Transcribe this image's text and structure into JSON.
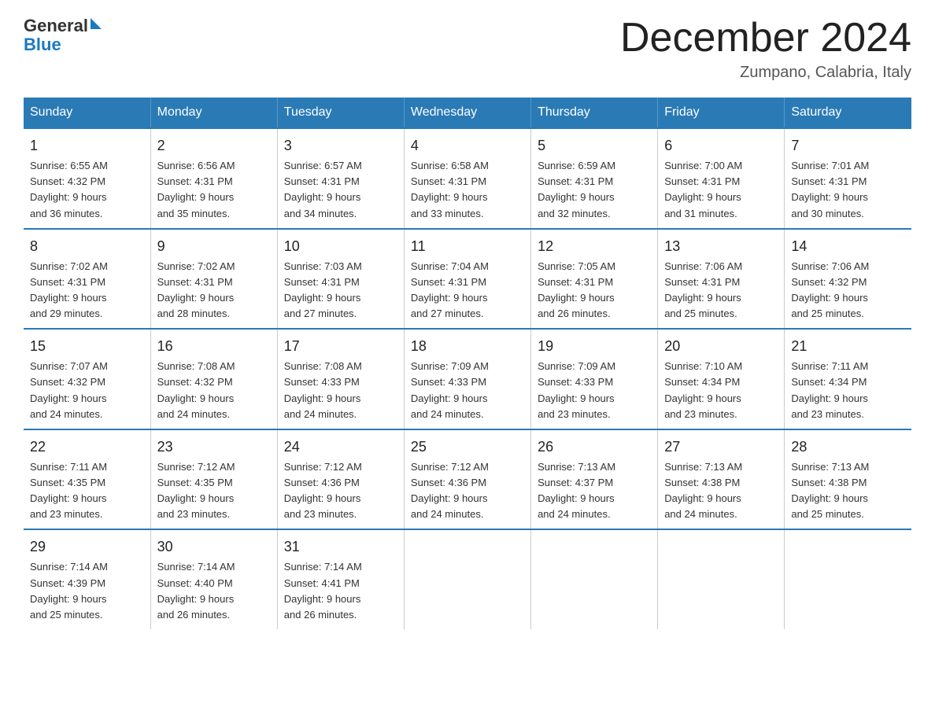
{
  "logo": {
    "line1": "General",
    "triangle": "▶",
    "line2": "Blue"
  },
  "title": "December 2024",
  "location": "Zumpano, Calabria, Italy",
  "days_of_week": [
    "Sunday",
    "Monday",
    "Tuesday",
    "Wednesday",
    "Thursday",
    "Friday",
    "Saturday"
  ],
  "weeks": [
    [
      {
        "day": "1",
        "sunrise": "6:55 AM",
        "sunset": "4:32 PM",
        "daylight": "9 hours and 36 minutes."
      },
      {
        "day": "2",
        "sunrise": "6:56 AM",
        "sunset": "4:31 PM",
        "daylight": "9 hours and 35 minutes."
      },
      {
        "day": "3",
        "sunrise": "6:57 AM",
        "sunset": "4:31 PM",
        "daylight": "9 hours and 34 minutes."
      },
      {
        "day": "4",
        "sunrise": "6:58 AM",
        "sunset": "4:31 PM",
        "daylight": "9 hours and 33 minutes."
      },
      {
        "day": "5",
        "sunrise": "6:59 AM",
        "sunset": "4:31 PM",
        "daylight": "9 hours and 32 minutes."
      },
      {
        "day": "6",
        "sunrise": "7:00 AM",
        "sunset": "4:31 PM",
        "daylight": "9 hours and 31 minutes."
      },
      {
        "day": "7",
        "sunrise": "7:01 AM",
        "sunset": "4:31 PM",
        "daylight": "9 hours and 30 minutes."
      }
    ],
    [
      {
        "day": "8",
        "sunrise": "7:02 AM",
        "sunset": "4:31 PM",
        "daylight": "9 hours and 29 minutes."
      },
      {
        "day": "9",
        "sunrise": "7:02 AM",
        "sunset": "4:31 PM",
        "daylight": "9 hours and 28 minutes."
      },
      {
        "day": "10",
        "sunrise": "7:03 AM",
        "sunset": "4:31 PM",
        "daylight": "9 hours and 27 minutes."
      },
      {
        "day": "11",
        "sunrise": "7:04 AM",
        "sunset": "4:31 PM",
        "daylight": "9 hours and 27 minutes."
      },
      {
        "day": "12",
        "sunrise": "7:05 AM",
        "sunset": "4:31 PM",
        "daylight": "9 hours and 26 minutes."
      },
      {
        "day": "13",
        "sunrise": "7:06 AM",
        "sunset": "4:31 PM",
        "daylight": "9 hours and 25 minutes."
      },
      {
        "day": "14",
        "sunrise": "7:06 AM",
        "sunset": "4:32 PM",
        "daylight": "9 hours and 25 minutes."
      }
    ],
    [
      {
        "day": "15",
        "sunrise": "7:07 AM",
        "sunset": "4:32 PM",
        "daylight": "9 hours and 24 minutes."
      },
      {
        "day": "16",
        "sunrise": "7:08 AM",
        "sunset": "4:32 PM",
        "daylight": "9 hours and 24 minutes."
      },
      {
        "day": "17",
        "sunrise": "7:08 AM",
        "sunset": "4:33 PM",
        "daylight": "9 hours and 24 minutes."
      },
      {
        "day": "18",
        "sunrise": "7:09 AM",
        "sunset": "4:33 PM",
        "daylight": "9 hours and 24 minutes."
      },
      {
        "day": "19",
        "sunrise": "7:09 AM",
        "sunset": "4:33 PM",
        "daylight": "9 hours and 23 minutes."
      },
      {
        "day": "20",
        "sunrise": "7:10 AM",
        "sunset": "4:34 PM",
        "daylight": "9 hours and 23 minutes."
      },
      {
        "day": "21",
        "sunrise": "7:11 AM",
        "sunset": "4:34 PM",
        "daylight": "9 hours and 23 minutes."
      }
    ],
    [
      {
        "day": "22",
        "sunrise": "7:11 AM",
        "sunset": "4:35 PM",
        "daylight": "9 hours and 23 minutes."
      },
      {
        "day": "23",
        "sunrise": "7:12 AM",
        "sunset": "4:35 PM",
        "daylight": "9 hours and 23 minutes."
      },
      {
        "day": "24",
        "sunrise": "7:12 AM",
        "sunset": "4:36 PM",
        "daylight": "9 hours and 23 minutes."
      },
      {
        "day": "25",
        "sunrise": "7:12 AM",
        "sunset": "4:36 PM",
        "daylight": "9 hours and 24 minutes."
      },
      {
        "day": "26",
        "sunrise": "7:13 AM",
        "sunset": "4:37 PM",
        "daylight": "9 hours and 24 minutes."
      },
      {
        "day": "27",
        "sunrise": "7:13 AM",
        "sunset": "4:38 PM",
        "daylight": "9 hours and 24 minutes."
      },
      {
        "day": "28",
        "sunrise": "7:13 AM",
        "sunset": "4:38 PM",
        "daylight": "9 hours and 25 minutes."
      }
    ],
    [
      {
        "day": "29",
        "sunrise": "7:14 AM",
        "sunset": "4:39 PM",
        "daylight": "9 hours and 25 minutes."
      },
      {
        "day": "30",
        "sunrise": "7:14 AM",
        "sunset": "4:40 PM",
        "daylight": "9 hours and 26 minutes."
      },
      {
        "day": "31",
        "sunrise": "7:14 AM",
        "sunset": "4:41 PM",
        "daylight": "9 hours and 26 minutes."
      },
      null,
      null,
      null,
      null
    ]
  ],
  "labels": {
    "sunrise": "Sunrise:",
    "sunset": "Sunset:",
    "daylight": "Daylight:"
  }
}
